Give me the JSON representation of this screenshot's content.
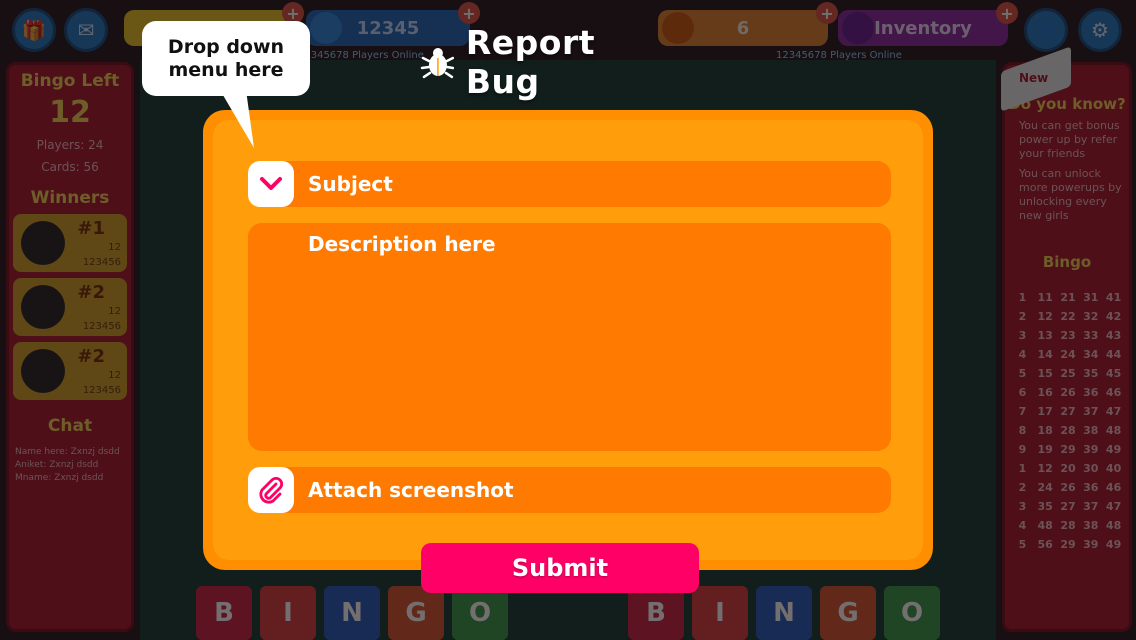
{
  "background": {
    "top_values": [
      "12345",
      "6"
    ],
    "top_inventory_label": "Inventory",
    "top_status_left": "12345678 Players Online",
    "top_status_right": "12345678 Players Online",
    "left_panel": {
      "title": "Bingo Left",
      "count": "12",
      "players": "Players: 24",
      "cards": "Cards: 56",
      "winners_title": "Winners",
      "winners": [
        {
          "rank": "#1",
          "score": "12",
          "id": "123456"
        },
        {
          "rank": "#2",
          "score": "12",
          "id": "123456"
        },
        {
          "rank": "#2",
          "score": "12",
          "id": "123456"
        }
      ],
      "chat_title": "Chat",
      "chat_lines": [
        "Name here: Zxnzj dsdd",
        "Aniket: Zxnzj dsdd",
        "Mname: Zxnzj dsdd"
      ]
    },
    "right_panel": {
      "ribbon": "New",
      "title": "Do you know?",
      "tips": [
        "You can get bonus power up by refer your friends",
        "You can unlock more powerups by unlocking every new girls"
      ],
      "bingo_title": "Bingo",
      "grid": [
        "1",
        "11",
        "21",
        "31",
        "41",
        "2",
        "12",
        "22",
        "32",
        "42",
        "3",
        "13",
        "23",
        "33",
        "43",
        "4",
        "14",
        "24",
        "34",
        "44",
        "5",
        "15",
        "25",
        "35",
        "45",
        "6",
        "16",
        "26",
        "36",
        "46",
        "7",
        "17",
        "27",
        "37",
        "47",
        "8",
        "18",
        "28",
        "38",
        "48",
        "9",
        "19",
        "29",
        "39",
        "49",
        "1",
        "12",
        "20",
        "30",
        "40",
        "2",
        "24",
        "26",
        "36",
        "46",
        "3",
        "35",
        "27",
        "37",
        "47",
        "4",
        "48",
        "28",
        "38",
        "48",
        "5",
        "56",
        "29",
        "39",
        "49"
      ]
    },
    "bingo_letters": [
      "B",
      "I",
      "N",
      "G",
      "O"
    ],
    "colors": {
      "b": "#d81b3c",
      "i": "#e53935",
      "n": "#1e5bc6",
      "g": "#e0522a",
      "o": "#2e9b3f"
    }
  },
  "modal": {
    "title": "Report Bug",
    "title_icon": "bug-icon",
    "subject_icon": "chevron-down-icon",
    "subject_label": "Subject",
    "description_placeholder": "Description here",
    "attach_icon": "paperclip-icon",
    "attach_label": "Attach screenshot",
    "submit_label": "Submit",
    "colors": {
      "panel": "#ff9d0a",
      "field": "#ff7a00",
      "submit": "#ff0066",
      "icon_accent": "#ff0066"
    }
  },
  "annotation": {
    "bubble_text": "Drop down\nmenu here"
  }
}
